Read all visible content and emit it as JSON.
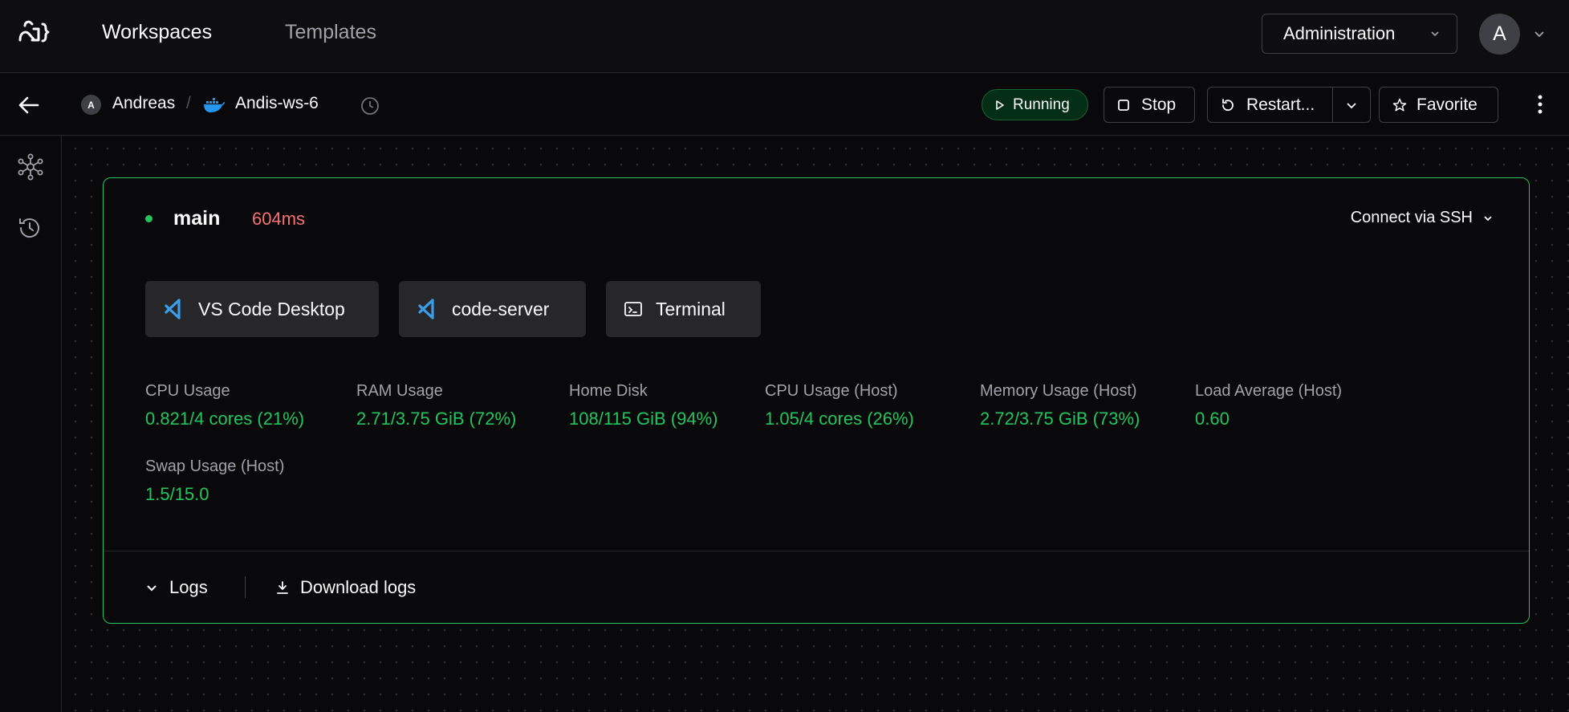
{
  "topbar": {
    "nav": {
      "workspaces": "Workspaces",
      "templates": "Templates"
    },
    "admin_label": "Administration",
    "user_initial": "A"
  },
  "breadcrumb": {
    "owner_initial": "A",
    "owner": "Andreas",
    "separator": "/",
    "workspace": "Andis-ws-6"
  },
  "actions": {
    "status": "Running",
    "stop": "Stop",
    "restart": "Restart...",
    "favorite": "Favorite"
  },
  "agent": {
    "name": "main",
    "latency": "604ms",
    "ssh_label": "Connect via SSH",
    "apps": [
      {
        "label": "VS Code Desktop",
        "icon": "vscode-icon"
      },
      {
        "label": "code-server",
        "icon": "vscode-icon"
      },
      {
        "label": "Terminal",
        "icon": "terminal-icon"
      }
    ],
    "metrics": [
      {
        "label": "CPU Usage",
        "value": "0.821/4 cores (21%)"
      },
      {
        "label": "RAM Usage",
        "value": "2.71/3.75 GiB (72%)"
      },
      {
        "label": "Home Disk",
        "value": "108/115 GiB (94%)"
      },
      {
        "label": "CPU Usage (Host)",
        "value": "1.05/4 cores (26%)"
      },
      {
        "label": "Memory Usage (Host)",
        "value": "2.72/3.75 GiB (73%)"
      },
      {
        "label": "Load Average (Host)",
        "value": "0.60"
      },
      {
        "label": "Swap Usage (Host)",
        "value": "1.5/15.0"
      }
    ],
    "logs_label": "Logs",
    "download_logs_label": "Download logs"
  },
  "colors": {
    "success": "#22c55e",
    "latency": "#f87171",
    "background": "#09090b"
  }
}
